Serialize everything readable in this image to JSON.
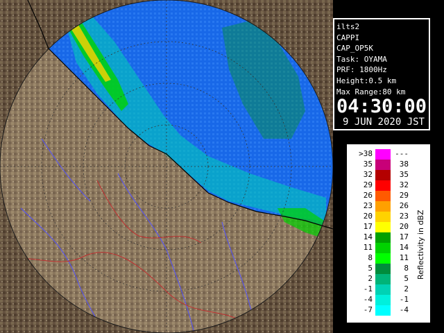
{
  "info": {
    "lines": [
      "ilts2",
      "CAPPI",
      "CAP_OP5K",
      "Task: OYAMA",
      "PRF: 1800Hz",
      "Height:0.5 km",
      "Max Range:80 km"
    ],
    "time": "04:30:00",
    "date": "9 JUN 2020 JST"
  },
  "legend": {
    "title": "Reflectivity in dBZ",
    "rows": [
      {
        "left": ">38",
        "right": "---",
        "color": "#ff00ff"
      },
      {
        "left": "35",
        "right": "38",
        "color": "#c80078"
      },
      {
        "left": "32",
        "right": "35",
        "color": "#b40000"
      },
      {
        "left": "29",
        "right": "32",
        "color": "#ff0000"
      },
      {
        "left": "26",
        "right": "29",
        "color": "#ff5a00"
      },
      {
        "left": "23",
        "right": "26",
        "color": "#ffa000"
      },
      {
        "left": "20",
        "right": "23",
        "color": "#ffd200"
      },
      {
        "left": "17",
        "right": "20",
        "color": "#ffff00"
      },
      {
        "left": "14",
        "right": "17",
        "color": "#00a000"
      },
      {
        "left": "11",
        "right": "14",
        "color": "#00d200"
      },
      {
        "left": "8",
        "right": "11",
        "color": "#00ff00"
      },
      {
        "left": "5",
        "right": "8",
        "color": "#008c3c"
      },
      {
        "left": "2",
        "right": "5",
        "color": "#00b478"
      },
      {
        "left": "-1",
        "right": "2",
        "color": "#00d2b4"
      },
      {
        "left": "-4",
        "right": "-1",
        "color": "#00f0dc"
      },
      {
        "left": "-7",
        "right": "-4",
        "color": "#00ffff"
      }
    ]
  },
  "colors": {
    "sea": "#1c6cf0",
    "land": "#7a6248",
    "land_light": "#9a8668",
    "outside": "#5a4a3a"
  }
}
